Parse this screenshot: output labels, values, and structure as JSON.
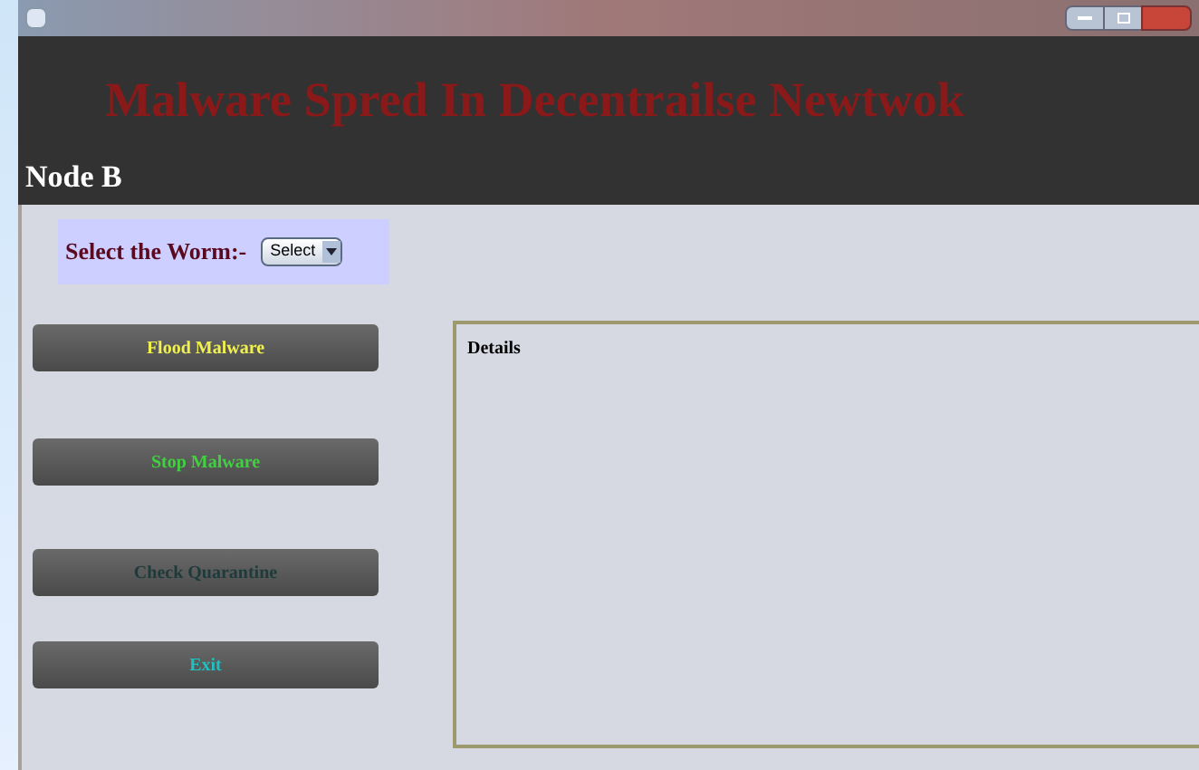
{
  "header": {
    "title": "Malware Spred In Decentrailse Newtwok",
    "node": "Node B"
  },
  "worm": {
    "label": "Select the Worm:-",
    "value": "Select"
  },
  "buttons": [
    {
      "label": "Flood Malware",
      "color": "#f0f050"
    },
    {
      "label": "Stop Malware",
      "color": "#40d040"
    },
    {
      "label": "Check Quarantine",
      "color": "#1f3a3a"
    },
    {
      "label": "Exit",
      "color": "#20c0c0"
    }
  ],
  "details": {
    "title": "Details"
  }
}
